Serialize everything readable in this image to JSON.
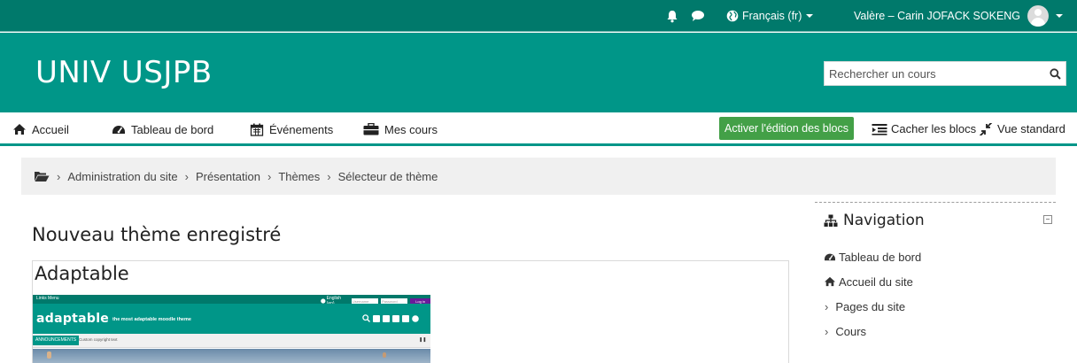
{
  "topbar": {
    "language": "Français (fr)",
    "user_name": "Valère – Carin JOFACK SOKENG"
  },
  "header": {
    "site_name": "UNIV USJPB",
    "search_placeholder": "Rechercher un cours"
  },
  "nav": {
    "items": [
      {
        "label": "Accueil",
        "icon": "home-icon"
      },
      {
        "label": "Tableau de bord",
        "icon": "dashboard-icon"
      },
      {
        "label": "Événements",
        "icon": "calendar-icon"
      },
      {
        "label": "Mes cours",
        "icon": "briefcase-icon"
      }
    ],
    "edit_button": "Activer l'édition des blocs",
    "hide_blocks": "Cacher les blocs",
    "standard_view": "Vue standard"
  },
  "breadcrumb": [
    "Administration du site",
    "Présentation",
    "Thèmes",
    "Sélecteur de thème"
  ],
  "main": {
    "heading": "Nouveau thème enregistré",
    "theme_name": "Adaptable",
    "preview": {
      "menu_label": "Links Menu",
      "lang_label": "English (en)",
      "username_placeholder": "Username",
      "password_placeholder": "Password",
      "login_label": "Log in",
      "logo": "adaptable",
      "tagline": "the most adaptable moodle theme",
      "announcements": "ANNOUNCEMENTS",
      "copyright": "Custom copyright text"
    }
  },
  "navigation_block": {
    "title": "Navigation",
    "items": [
      {
        "label": "Tableau de bord",
        "icon": "dashboard-icon"
      },
      {
        "label": "Accueil du site",
        "icon": "home-icon"
      },
      {
        "label": "Pages du site",
        "icon": "chevron-right-icon"
      },
      {
        "label": "Cours",
        "icon": "chevron-right-icon"
      }
    ]
  },
  "colors": {
    "topbar": "#00796b",
    "header": "#009688",
    "accent": "#009688",
    "edit_button": "#43a047",
    "breadcrumb_bg": "#f0f0f0"
  }
}
